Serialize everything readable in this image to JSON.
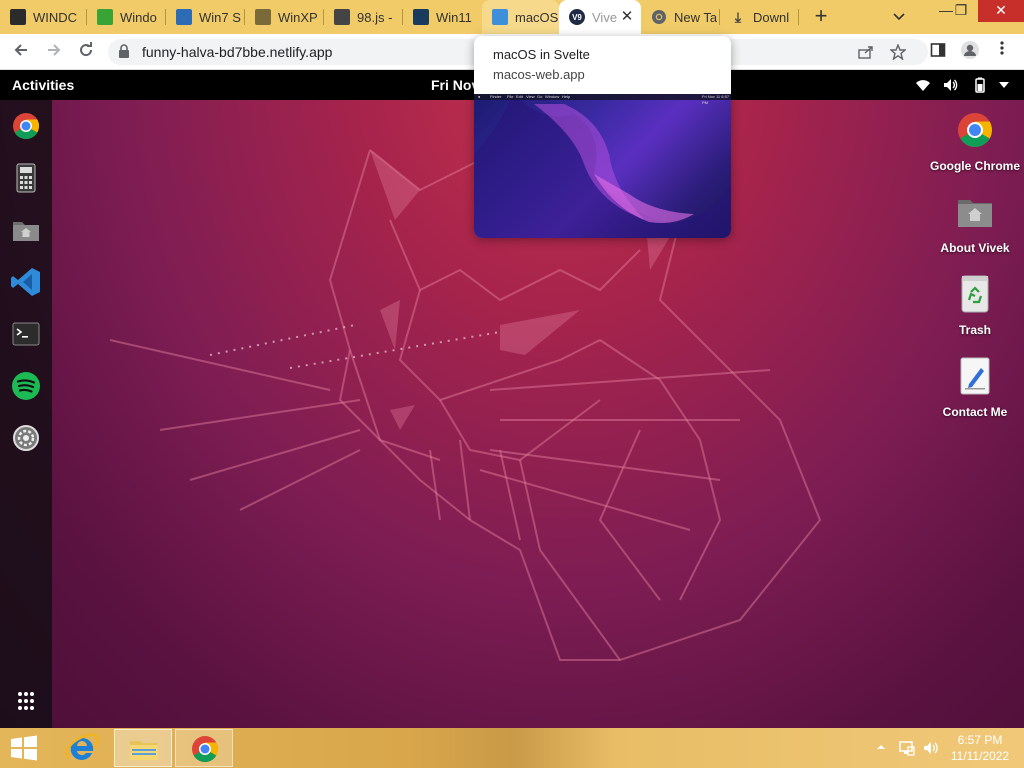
{
  "browser": {
    "tabs": [
      {
        "title": "WINDC",
        "icon": "windows-tab-icon",
        "color": "#2b2b2b"
      },
      {
        "title": "Windo",
        "icon": "windows-green-tab-icon",
        "color": "#3aa335"
      },
      {
        "title": "Win7 S",
        "icon": "win7-tab-icon",
        "color": "#2d6bb5"
      },
      {
        "title": "WinXP",
        "icon": "winxp-tab-icon",
        "color": "#7a6a3a"
      },
      {
        "title": "98.js -",
        "icon": "98js-tab-icon",
        "color": "#444444"
      },
      {
        "title": "Win11",
        "icon": "win11-tab-icon",
        "color": "#1a3b5c"
      },
      {
        "title": "macOS",
        "icon": "finder-tab-icon",
        "color": "#3d8fd9"
      },
      {
        "title": "Vive",
        "icon": "v9-tab-icon",
        "color": "#1f2a44",
        "badge": "V9"
      },
      {
        "title": "New Ta",
        "icon": "chrome-tab-icon",
        "color": "#5f6368"
      },
      {
        "title": "Downl",
        "icon": "download-tab-icon",
        "color": "#444444"
      }
    ],
    "url": "funny-halva-bd7bbe.netlify.app",
    "new_tab": "+",
    "tab_search": "⌄",
    "win_min": "—",
    "win_max": "❐",
    "win_close": "✕"
  },
  "hover_card": {
    "title": "macOS in Svelte",
    "domain": "macos-web.app",
    "preview_menu": [
      "Finder",
      "File",
      "Edit",
      "View",
      "Go",
      "Window",
      "Help"
    ],
    "preview_clock": "Fri Nov 11 6:57 PM"
  },
  "ubuntu": {
    "activities": "Activities",
    "clock": "Fri Nov",
    "dock": [
      {
        "name": "chrome-dock-icon"
      },
      {
        "name": "calculator-dock-icon"
      },
      {
        "name": "files-dock-icon"
      },
      {
        "name": "vscode-dock-icon"
      },
      {
        "name": "terminal-dock-icon"
      },
      {
        "name": "spotify-dock-icon"
      },
      {
        "name": "settings-dock-icon"
      },
      {
        "name": "app-grid-icon"
      }
    ],
    "desktop_icons": [
      {
        "label": "Google Chrome",
        "icon": "chrome-icon"
      },
      {
        "label": "About Vivek",
        "icon": "home-folder-icon"
      },
      {
        "label": "Trash",
        "icon": "trash-icon"
      },
      {
        "label": "Contact Me",
        "icon": "notepad-icon"
      }
    ]
  },
  "taskbar": {
    "time": "6:57 PM",
    "date": "11/11/2022"
  },
  "colors": {
    "tabstrip": "#f0cb68",
    "ubuntu_top": "#c4324b",
    "ubuntu_bottom": "#4b0f36"
  }
}
